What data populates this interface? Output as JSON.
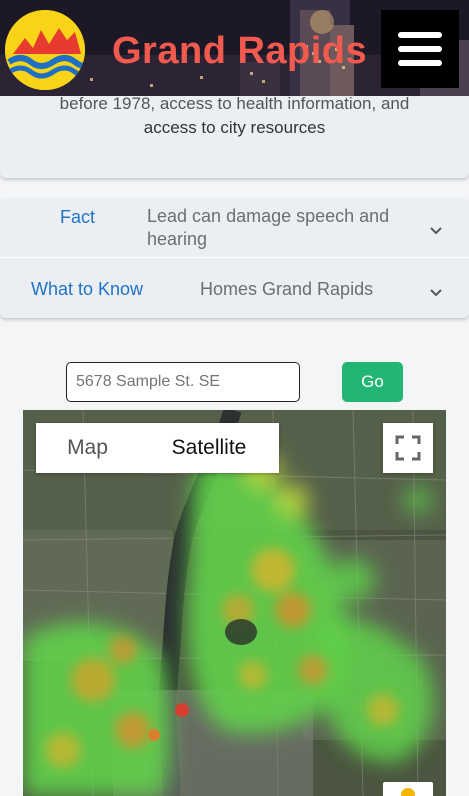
{
  "header": {
    "brand": "Grand Rapids",
    "logo_icon": "city-logo-icon",
    "menu_icon": "hamburger-menu-icon"
  },
  "intro": {
    "line1": "before 1978, access to health information, and",
    "line2": "access to city resources"
  },
  "accordion": {
    "items": [
      {
        "key": "Fact",
        "value": "Lead can damage speech and hearing",
        "icon": "chevron-down-icon"
      },
      {
        "key": "What to Know",
        "value": "Homes Grand Rapids",
        "icon": "chevron-down-icon"
      }
    ]
  },
  "search": {
    "placeholder": "5678 Sample St. SE",
    "go_label": "Go"
  },
  "map": {
    "map_tab": "Map",
    "satellite_tab": "Satellite",
    "selected_tab": "Satellite",
    "fullscreen_icon": "fullscreen-icon",
    "pegman_icon": "pegman-icon"
  },
  "colors": {
    "brand": "#f05a4f",
    "link": "#1f74c8",
    "go_button": "#22b573"
  }
}
